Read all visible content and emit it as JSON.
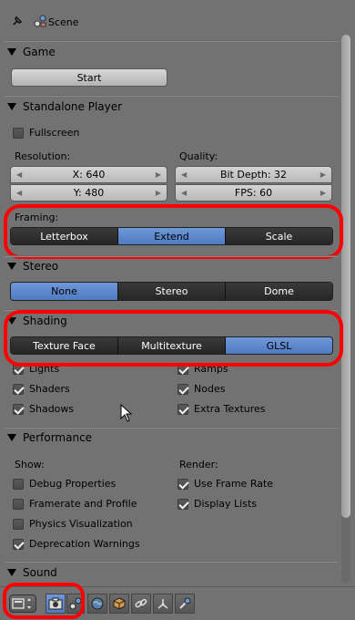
{
  "header": {
    "breadcrumb_label": "Scene"
  },
  "sections": {
    "game": {
      "title": "Game",
      "start_label": "Start"
    },
    "standalone": {
      "title": "Standalone Player",
      "fullscreen_label": "Fullscreen",
      "fullscreen_checked": false,
      "resolution_label": "Resolution:",
      "quality_label": "Quality:",
      "res_x": "X: 640",
      "res_y": "Y: 480",
      "bit_depth": "Bit Depth: 32",
      "fps": "FPS: 60",
      "framing_label": "Framing:",
      "framing_options": [
        "Letterbox",
        "Extend",
        "Scale"
      ],
      "framing_selected": "Extend"
    },
    "stereo": {
      "title": "Stereo",
      "options": [
        "None",
        "Stereo",
        "Dome"
      ],
      "selected": "None"
    },
    "shading": {
      "title": "Shading",
      "options": [
        "Texture Face",
        "Multitexture",
        "GLSL"
      ],
      "selected": "GLSL",
      "left_checks": [
        "Lights",
        "Shaders",
        "Shadows"
      ],
      "right_checks": [
        "Ramps",
        "Nodes",
        "Extra Textures"
      ]
    },
    "performance": {
      "title": "Performance",
      "show_label": "Show:",
      "render_label": "Render:",
      "show_items": [
        "Debug Properties",
        "Framerate and Profile",
        "Physics Visualization",
        "Deprecation Warnings"
      ],
      "render_items": [
        "Use Frame Rate",
        "Display Lists"
      ]
    },
    "sound": {
      "title": "Sound"
    }
  },
  "icons": {
    "pin": "pin-icon",
    "scene": "scene-icon",
    "editor_type": "editor-type-icon",
    "render": "render-icon",
    "scene_tab": "scene-tab-icon",
    "world": "world-icon",
    "object": "object-icon",
    "constraints": "constraint-icon",
    "modifiers": "modifier-icon",
    "physics": "physics-icon"
  },
  "colors": {
    "accent": "#5a86cc",
    "highlight_ring": "#ff0000",
    "panel": "#727272"
  }
}
